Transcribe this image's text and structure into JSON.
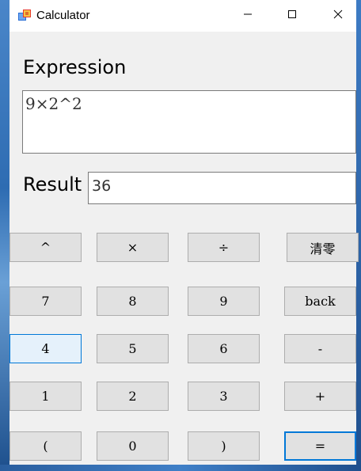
{
  "window": {
    "title": "Calculator",
    "minimize_glyph": "—",
    "maximize_glyph": "☐",
    "close_glyph": "✕"
  },
  "expression": {
    "label": "Expression",
    "value": "9×2^2"
  },
  "result": {
    "label": "Result",
    "value": "36"
  },
  "keys": {
    "power": "^",
    "multiply": "×",
    "divide": "÷",
    "clear": "清零",
    "seven": "7",
    "eight": "8",
    "nine": "9",
    "back": "back",
    "four": "4",
    "five": "5",
    "six": "6",
    "minus": "-",
    "one": "1",
    "two": "2",
    "three": "3",
    "plus": "+",
    "open_paren": "(",
    "zero": "0",
    "close_paren": ")",
    "equals": "="
  },
  "icons": {
    "app": "app-window-icon",
    "minimize": "minimize-icon",
    "maximize": "maximize-icon",
    "close": "close-icon"
  },
  "colors": {
    "focus_border": "#0078d7",
    "button_face": "#e1e1e1",
    "window_bg": "#f0f0f0"
  }
}
